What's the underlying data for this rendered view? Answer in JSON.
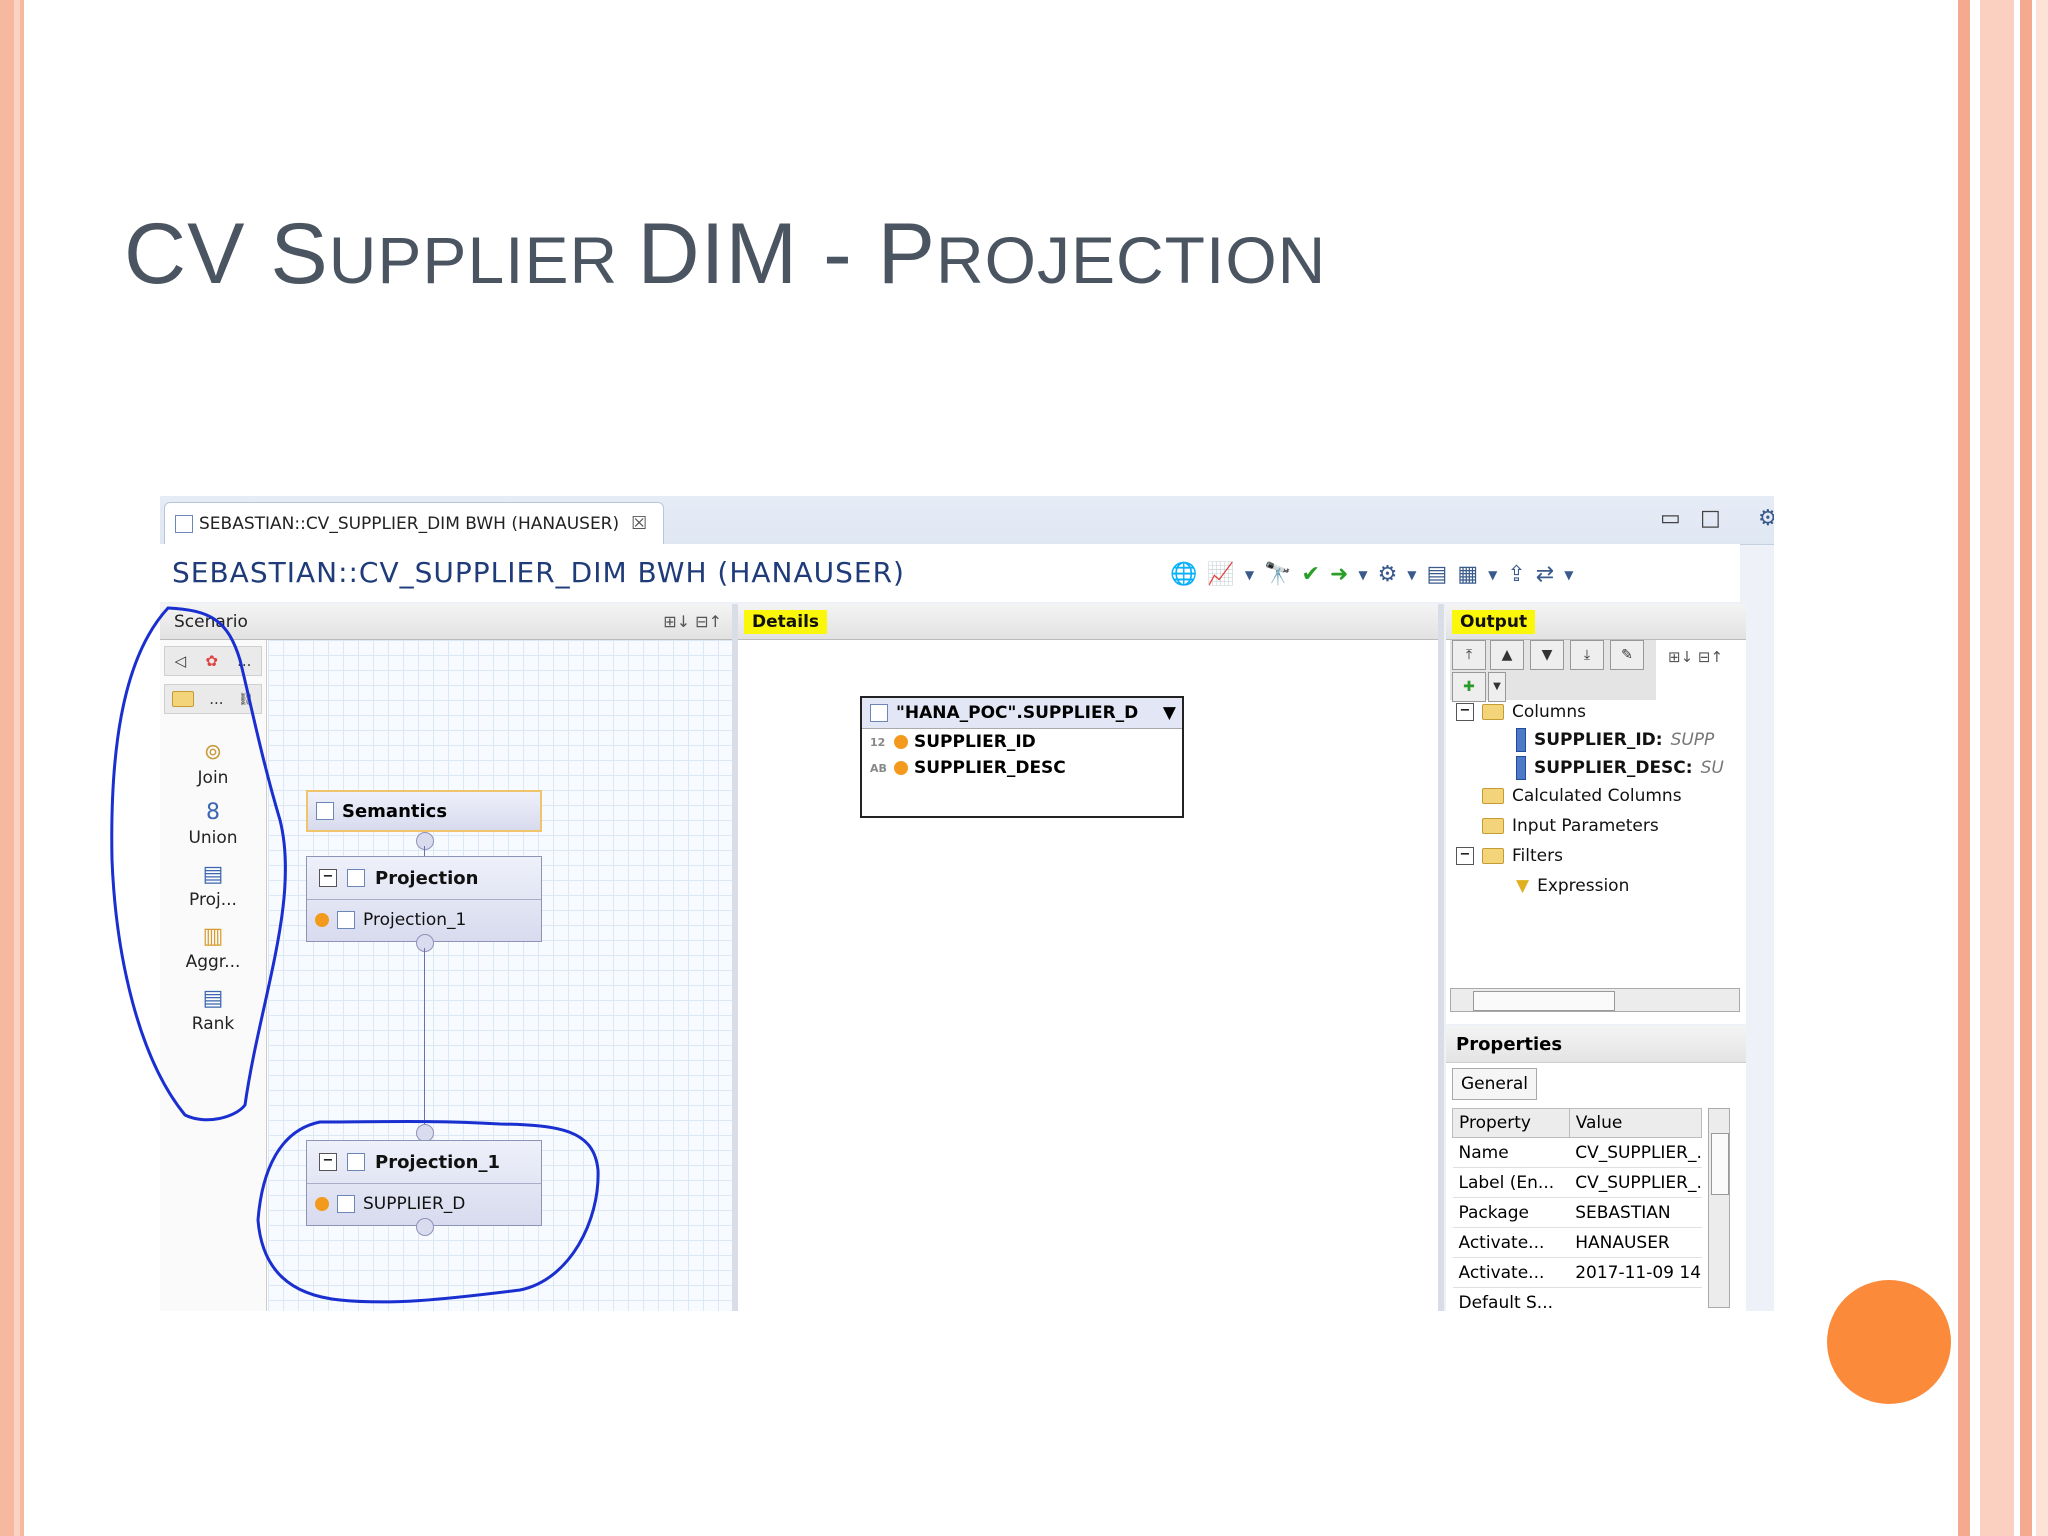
{
  "slide": {
    "title_parts": [
      "CV ",
      "S",
      "UPPLIER ",
      "DIM - ",
      "P",
      "ROJECTION"
    ]
  },
  "editor": {
    "tab_label": "SEBASTIAN::CV_SUPPLIER_DIM BWH (HANAUSER)",
    "title": "SEBASTIAN::CV_SUPPLIER_DIM BWH (HANAUSER)"
  },
  "scenario": {
    "header": "Scenario",
    "palette": [
      "Join",
      "Union",
      "Proj...",
      "Aggr...",
      "Rank"
    ],
    "palette_more": "...",
    "nodes": {
      "semantics": "Semantics",
      "projection": {
        "title": "Projection",
        "child": "Projection_1"
      },
      "projection_1": {
        "title": "Projection_1",
        "child": "SUPPLIER_D"
      }
    }
  },
  "details": {
    "header": "Details",
    "table": {
      "name": "\"HANA_POC\".SUPPLIER_D",
      "columns": [
        {
          "type": "12",
          "name": "SUPPLIER_ID"
        },
        {
          "type": "AB",
          "name": "SUPPLIER_DESC"
        }
      ]
    }
  },
  "output": {
    "header": "Output",
    "tree": {
      "columns": "Columns",
      "col1": {
        "name": "SUPPLIER_ID:",
        "desc": "SUPP"
      },
      "col2": {
        "name": "SUPPLIER_DESC:",
        "desc": "SU"
      },
      "calculated": "Calculated Columns",
      "input_params": "Input Parameters",
      "filters": "Filters",
      "expression": "Expression"
    }
  },
  "properties": {
    "header": "Properties",
    "tab": "General",
    "col_property": "Property",
    "col_value": "Value",
    "rows": [
      {
        "p": "Name",
        "v": "CV_SUPPLIER_."
      },
      {
        "p": "Label (En...",
        "v": "CV_SUPPLIER_."
      },
      {
        "p": "Package",
        "v": "SEBASTIAN"
      },
      {
        "p": "Activate...",
        "v": "HANAUSER"
      },
      {
        "p": "Activate...",
        "v": "2017-11-09 14."
      },
      {
        "p": "Default S...",
        "v": ""
      }
    ]
  },
  "colors": {
    "highlight": "#fbf70a",
    "annotation_ink": "#1a2fd0",
    "accent_orange": "#fb8b3b"
  }
}
